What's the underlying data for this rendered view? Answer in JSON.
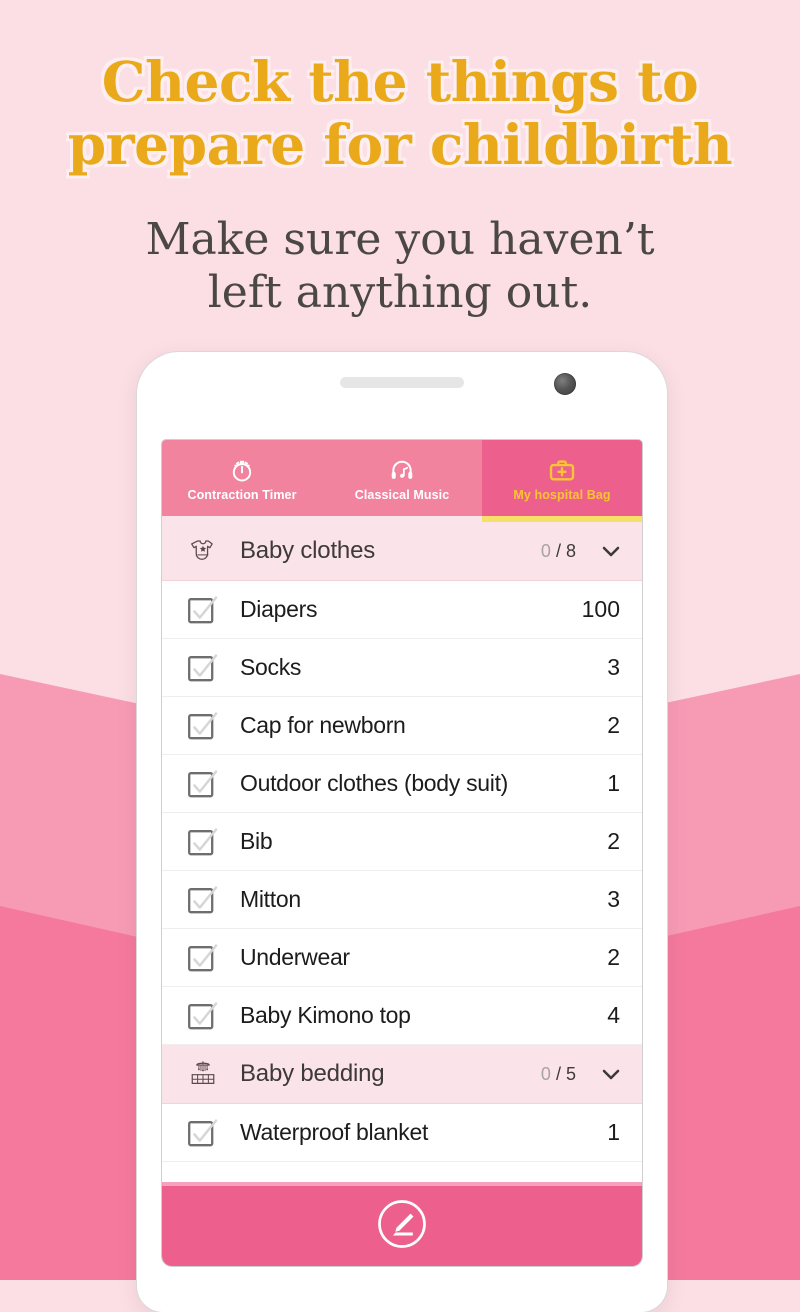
{
  "promo": {
    "headline_line1": "Check the things to",
    "headline_line2": "prepare for childbirth",
    "subhead_line1": "Make sure you haven’t",
    "subhead_line2": "left anything out.",
    "headline_color": "#eaa91b",
    "subhead_color": "#4a4744"
  },
  "background": {
    "base_color": "#fbdfe4",
    "band_light": "#fbdfe4",
    "band_mid": "#f79bb5",
    "band_dark": "#f4799d"
  },
  "app": {
    "accent_pink": "#ed5f8c",
    "tab_pink": "#f2839f",
    "accent_yellow": "#f9c433",
    "section_bg": "#fbe4e9",
    "tabs": [
      {
        "label": "Contraction Timer",
        "icon": "stopwatch-icon",
        "active": false
      },
      {
        "label": "Classical Music",
        "icon": "headphones-note-icon",
        "active": false
      },
      {
        "label": "My hospital Bag",
        "icon": "medical-bag-icon",
        "active": true
      }
    ],
    "sections": [
      {
        "title": "Baby clothes",
        "icon": "onesie-icon",
        "checked": "0",
        "separator": "/",
        "total": "8",
        "chevron": "chevron-down-icon",
        "items": [
          {
            "label": "Diapers",
            "qty": "100",
            "checked": false
          },
          {
            "label": "Socks",
            "qty": "3",
            "checked": false
          },
          {
            "label": "Cap for newborn",
            "qty": "2",
            "checked": false
          },
          {
            "label": "Outdoor clothes (body suit)",
            "qty": "1",
            "checked": false
          },
          {
            "label": "Bib",
            "qty": "2",
            "checked": false
          },
          {
            "label": "Mitton",
            "qty": "3",
            "checked": false
          },
          {
            "label": "Underwear",
            "qty": "2",
            "checked": false
          },
          {
            "label": "Baby Kimono top",
            "qty": "4",
            "checked": false
          }
        ]
      },
      {
        "title": "Baby bedding",
        "icon": "crib-icon",
        "checked": "0",
        "separator": "/",
        "total": "5",
        "chevron": "chevron-down-icon",
        "items": [
          {
            "label": "Waterproof blanket",
            "qty": "1",
            "checked": false
          }
        ]
      }
    ],
    "action_bar": {
      "icon": "edit-pencil-circle-icon"
    }
  }
}
